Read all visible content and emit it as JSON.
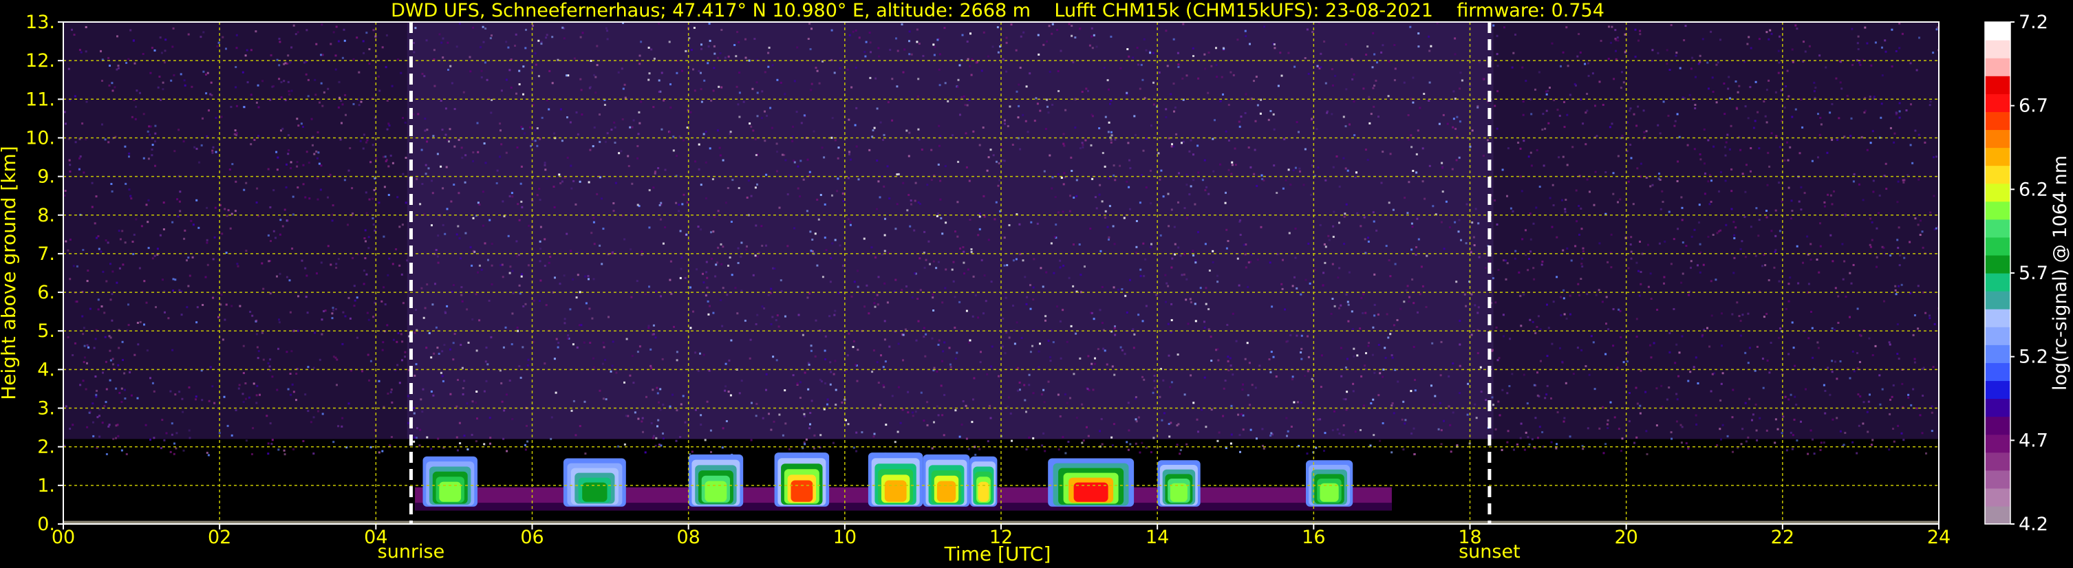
{
  "chart_data": {
    "type": "heatmap",
    "title": "DWD UFS, Schneefernerhaus; 47.417° N 10.980° E, altitude: 2668 m    Lufft CHM15k (CHM15kUFS): 23-08-2021    firmware: 0.754",
    "xlabel": "Time [UTC]",
    "ylabel": "Height above ground [km]",
    "colorbar_label": "log(rc-signal) @ 1064 nm",
    "xlim": [
      0,
      24
    ],
    "ylim": [
      0,
      13
    ],
    "x_ticks": [
      "00",
      "02",
      "04",
      "06",
      "08",
      "10",
      "12",
      "14",
      "16",
      "18",
      "20",
      "22",
      "24"
    ],
    "y_ticks": [
      "0.",
      "1.",
      "2.",
      "3.",
      "4.",
      "5.",
      "6.",
      "7.",
      "8.",
      "9.",
      "10.",
      "11.",
      "12.",
      "13."
    ],
    "colorbar_range": [
      4.2,
      7.2
    ],
    "colorbar_ticks": [
      "7.2",
      "6.7",
      "6.2",
      "5.7",
      "5.2",
      "4.7",
      "4.2"
    ],
    "colorbar_colors": [
      "#a68fa6",
      "#b37fae",
      "#a15b9e",
      "#8c3388",
      "#750f78",
      "#5c0072",
      "#3a00a0",
      "#1a1ae0",
      "#3a5aff",
      "#5f86ff",
      "#8aa8ff",
      "#a9c0ff",
      "#3aa7a0",
      "#14c37c",
      "#0a9a1e",
      "#22c84a",
      "#44e070",
      "#82ff3c",
      "#d8ff20",
      "#ffe020",
      "#ffb000",
      "#ff8000",
      "#ff4000",
      "#ff1010",
      "#e80000",
      "#ffb0b0",
      "#ffdddd",
      "#ffffff"
    ],
    "events": [
      {
        "label": "sunrise",
        "x": 4.45
      },
      {
        "label": "sunset",
        "x": 18.25
      }
    ],
    "cloud_segments": [
      {
        "x0": 4.6,
        "x1": 5.3,
        "top": 1.75,
        "peak": 6.2
      },
      {
        "x0": 6.4,
        "x1": 7.2,
        "top": 1.7,
        "peak": 5.9
      },
      {
        "x0": 8.0,
        "x1": 8.7,
        "top": 1.8,
        "peak": 6.3
      },
      {
        "x0": 9.1,
        "x1": 9.8,
        "top": 1.85,
        "peak": 6.9
      },
      {
        "x0": 10.3,
        "x1": 11.0,
        "top": 1.85,
        "peak": 6.6
      },
      {
        "x0": 11.0,
        "x1": 11.6,
        "top": 1.8,
        "peak": 6.6
      },
      {
        "x0": 11.6,
        "x1": 11.95,
        "top": 1.75,
        "peak": 6.5
      },
      {
        "x0": 12.6,
        "x1": 13.7,
        "top": 1.7,
        "peak": 7.0
      },
      {
        "x0": 14.0,
        "x1": 14.55,
        "top": 1.65,
        "peak": 6.3
      },
      {
        "x0": 15.9,
        "x1": 16.5,
        "top": 1.65,
        "peak": 6.2
      }
    ]
  }
}
